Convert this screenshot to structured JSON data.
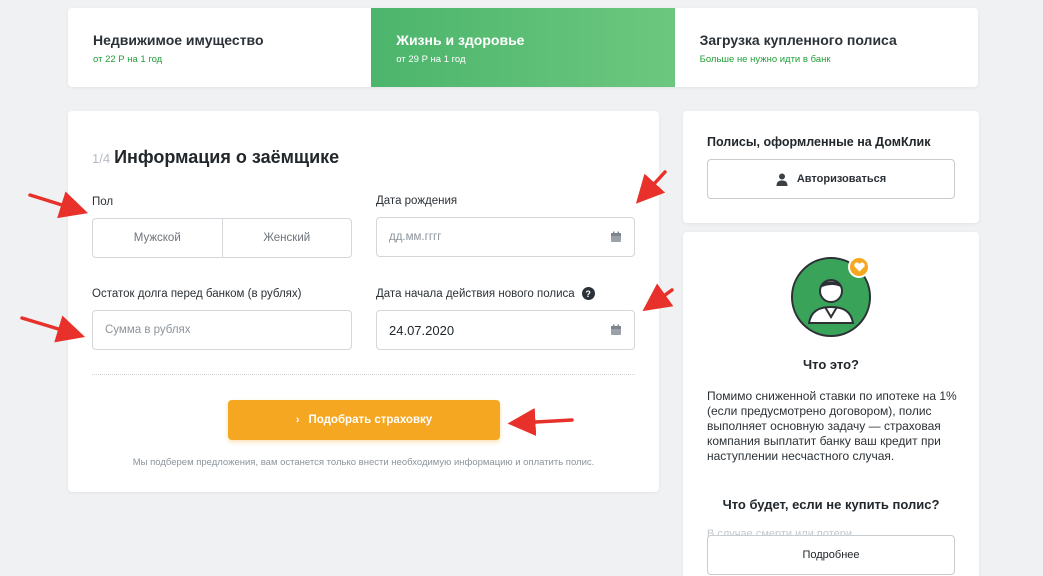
{
  "tabs": [
    {
      "title": "Недвижимое имущество",
      "sub": "от 22 Р на 1 год",
      "active": false
    },
    {
      "title": "Жизнь и здоровье",
      "sub": "от 29 Р на 1 год",
      "active": true
    },
    {
      "title": "Загрузка купленного полиса",
      "sub": "Больше не нужно идти в банк",
      "active": false
    }
  ],
  "form": {
    "step": "1/4",
    "title": "Информация о заёмщике",
    "gender_label": "Пол",
    "gender_male": "Мужской",
    "gender_female": "Женский",
    "birth_label": "Дата рождения",
    "birth_placeholder": "дд.мм.гггг",
    "debt_label": "Остаток долга перед банком (в рублях)",
    "debt_placeholder": "Сумма в рублях",
    "start_label": "Дата начала действия нового полиса",
    "start_help": "?",
    "start_value": "24.07.2020",
    "cta_chevron": "›",
    "cta_label": "Подобрать страховку",
    "note": "Мы подберем предложения, вам останется только внести необходимую информацию и оплатить полис."
  },
  "auth": {
    "title": "Полисы, оформленные на ДомКлик",
    "button": "Авторизоваться"
  },
  "info": {
    "title": "Что это?",
    "text": "Помимо сниженной ставки по ипотеке на 1% (если предусмотрено договором), полис выполняет основную задачу — страховая компания выплатит банку ваш кредит при наступлении несчастного случая.",
    "title2": "Что будет, если не купить полис?",
    "faded_text": "В случае смерти или потери",
    "more_button": "Подробнее"
  },
  "colors": {
    "accent_green": "#4cb56c",
    "accent_orange": "#f6a721",
    "arrow_red": "#e8312a"
  }
}
